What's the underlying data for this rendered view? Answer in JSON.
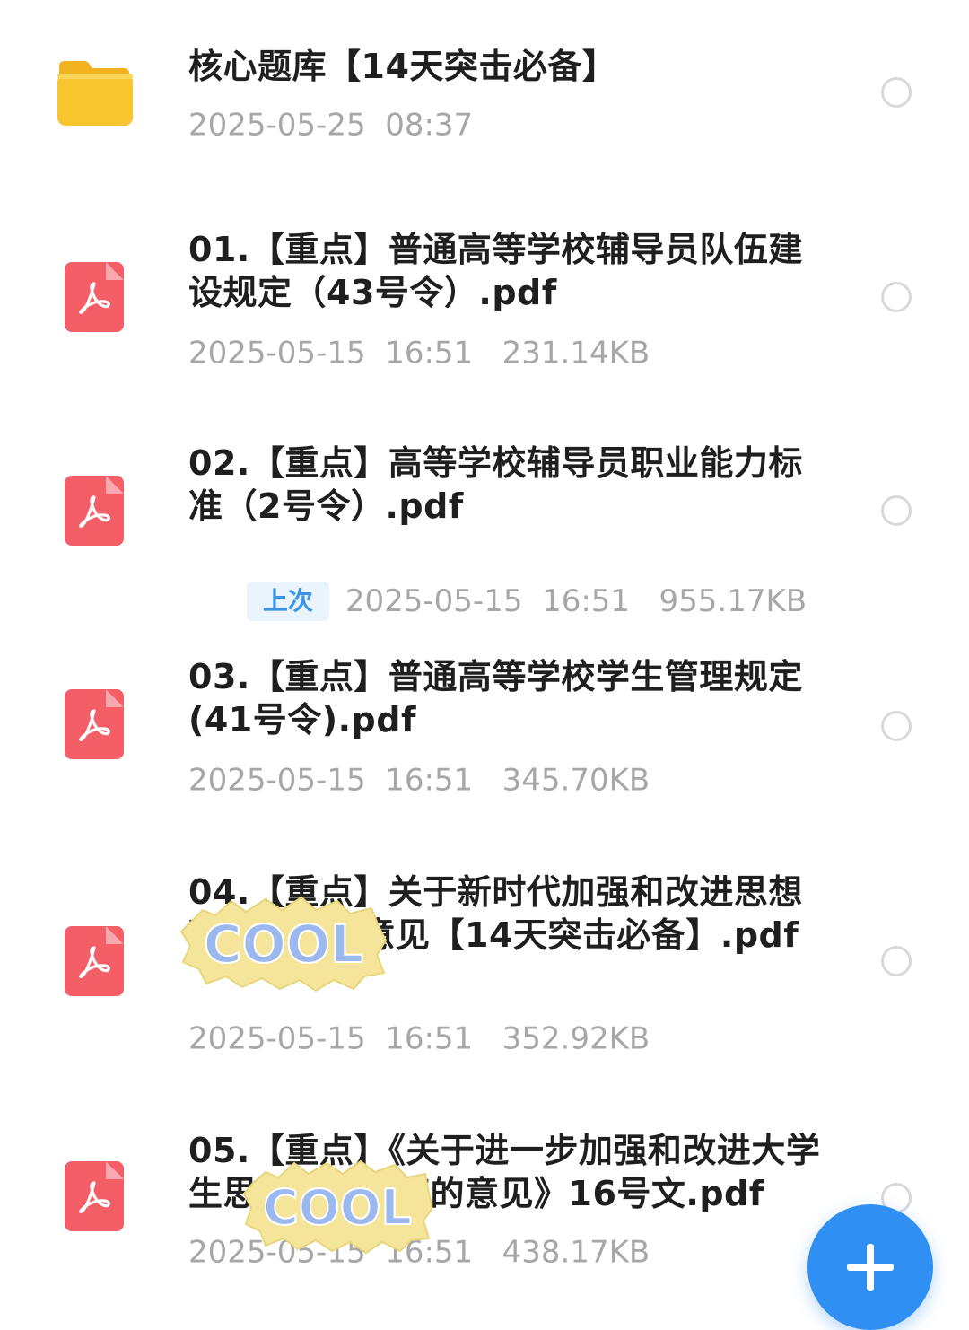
{
  "files": [
    {
      "type": "folder",
      "icon": "folder-icon",
      "title": "核心题库【14天突击必备】",
      "meta": "2025-05-25  08:37",
      "badge": ""
    },
    {
      "type": "pdf",
      "icon": "pdf-icon",
      "title": "01.【重点】普通高等学校辅导员队伍建设规定（43号令）.pdf",
      "meta": "2025-05-15  16:51   231.14KB",
      "badge": ""
    },
    {
      "type": "pdf",
      "icon": "pdf-icon",
      "title": "02.【重点】高等学校辅导员职业能力标准（2号令）.pdf",
      "meta": "2025-05-15  16:51   955.17KB",
      "badge": "上次"
    },
    {
      "type": "pdf",
      "icon": "pdf-icon",
      "title": "03.【重点】普通高等学校学生管理规定(41号令).pdf",
      "meta": "2025-05-15  16:51   345.70KB",
      "badge": ""
    },
    {
      "type": "pdf",
      "icon": "pdf-icon",
      "title": "04.【重点】关于新时代加强和改进思想政治工作的意见【14天突击必备】.pdf",
      "meta": "2025-05-15  16:51   352.92KB",
      "badge": ""
    },
    {
      "type": "pdf",
      "icon": "pdf-icon",
      "title": "05.【重点】《关于进一步加强和改进大学生思想政治教育的意见》16号文.pdf",
      "meta": "2025-05-15  16:51   438.17KB",
      "badge": ""
    }
  ],
  "stickers": [
    {
      "text": "COOL",
      "icon": "cool-sticker-icon"
    },
    {
      "text": "COOL",
      "icon": "cool-sticker-icon"
    }
  ],
  "fab": {
    "icon": "plus-icon"
  },
  "colors": {
    "folder": "#f8c52e",
    "pdf": "#f45f67",
    "accent": "#2f8ff2",
    "badge_text": "#3b93e4",
    "meta_text": "#a7a7a7"
  }
}
